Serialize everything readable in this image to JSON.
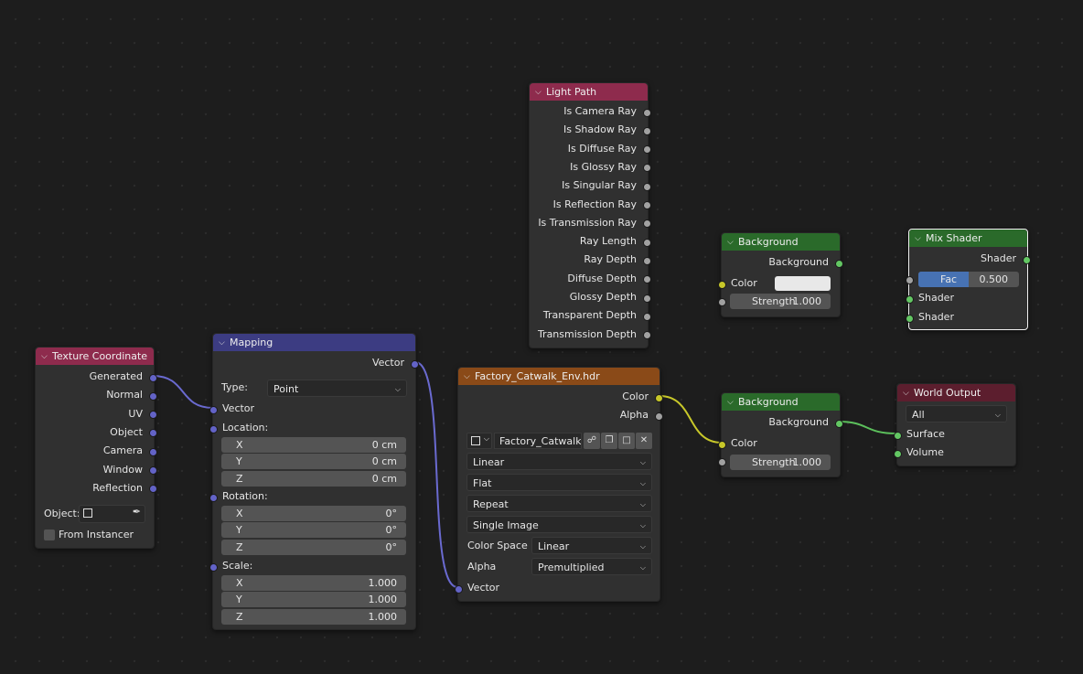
{
  "colors": {
    "light_path_header": "#8e2b4d",
    "texture_coord_header": "#8e2b4d",
    "mapping_header": "#3c3c82",
    "image_texture_header": "#8a4a18",
    "shader_header": "#2a6a2a",
    "output_header": "#5c1e2e",
    "socket_grey": "#a1a1a1",
    "socket_vector": "#6363c7",
    "socket_color": "#c7c729",
    "socket_shader": "#63c763"
  },
  "light_path": {
    "title": "Light Path",
    "outputs": [
      "Is Camera Ray",
      "Is Shadow Ray",
      "Is Diffuse Ray",
      "Is Glossy Ray",
      "Is Singular Ray",
      "Is Reflection Ray",
      "Is Transmission Ray",
      "Ray Length",
      "Ray Depth",
      "Diffuse Depth",
      "Glossy Depth",
      "Transparent Depth",
      "Transmission Depth"
    ]
  },
  "background_top": {
    "title": "Background",
    "output": "Background",
    "color_label": "Color",
    "strength_label": "Strength",
    "strength_value": "1.000",
    "color_swatch": "#e8e8e8"
  },
  "mix_shader": {
    "title": "Mix Shader",
    "output": "Shader",
    "fac_label": "Fac",
    "fac_value": "0.500",
    "fac_fraction": 0.5,
    "input1": "Shader",
    "input2": "Shader"
  },
  "texture_coordinate": {
    "title": "Texture Coordinate",
    "outputs": [
      "Generated",
      "Normal",
      "UV",
      "Object",
      "Camera",
      "Window",
      "Reflection"
    ],
    "object_label": "Object:",
    "from_instancer": "From Instancer"
  },
  "mapping": {
    "title": "Mapping",
    "output": "Vector",
    "type_label": "Type:",
    "type_value": "Point",
    "vector_label": "Vector",
    "location_label": "Location:",
    "location": [
      {
        "k": "X",
        "v": "0 cm"
      },
      {
        "k": "Y",
        "v": "0 cm"
      },
      {
        "k": "Z",
        "v": "0 cm"
      }
    ],
    "rotation_label": "Rotation:",
    "rotation": [
      {
        "k": "X",
        "v": "0°"
      },
      {
        "k": "Y",
        "v": "0°"
      },
      {
        "k": "Z",
        "v": "0°"
      }
    ],
    "scale_label": "Scale:",
    "scale": [
      {
        "k": "X",
        "v": "1.000"
      },
      {
        "k": "Y",
        "v": "1.000"
      },
      {
        "k": "Z",
        "v": "1.000"
      }
    ]
  },
  "image_texture": {
    "title": "Factory_Catwalk_Env.hdr",
    "out_color": "Color",
    "out_alpha": "Alpha",
    "image_name": "Factory_Catwalk_...",
    "interpolation": "Linear",
    "projection": "Flat",
    "extension": "Repeat",
    "source": "Single Image",
    "colorspace_label": "Color Space",
    "colorspace_value": "Linear",
    "alpha_label": "Alpha",
    "alpha_value": "Premultiplied",
    "vector_label": "Vector"
  },
  "background_bottom": {
    "title": "Background",
    "output": "Background",
    "color_label": "Color",
    "strength_label": "Strength",
    "strength_value": "1.000"
  },
  "world_output": {
    "title": "World Output",
    "target": "All",
    "surface": "Surface",
    "volume": "Volume"
  }
}
